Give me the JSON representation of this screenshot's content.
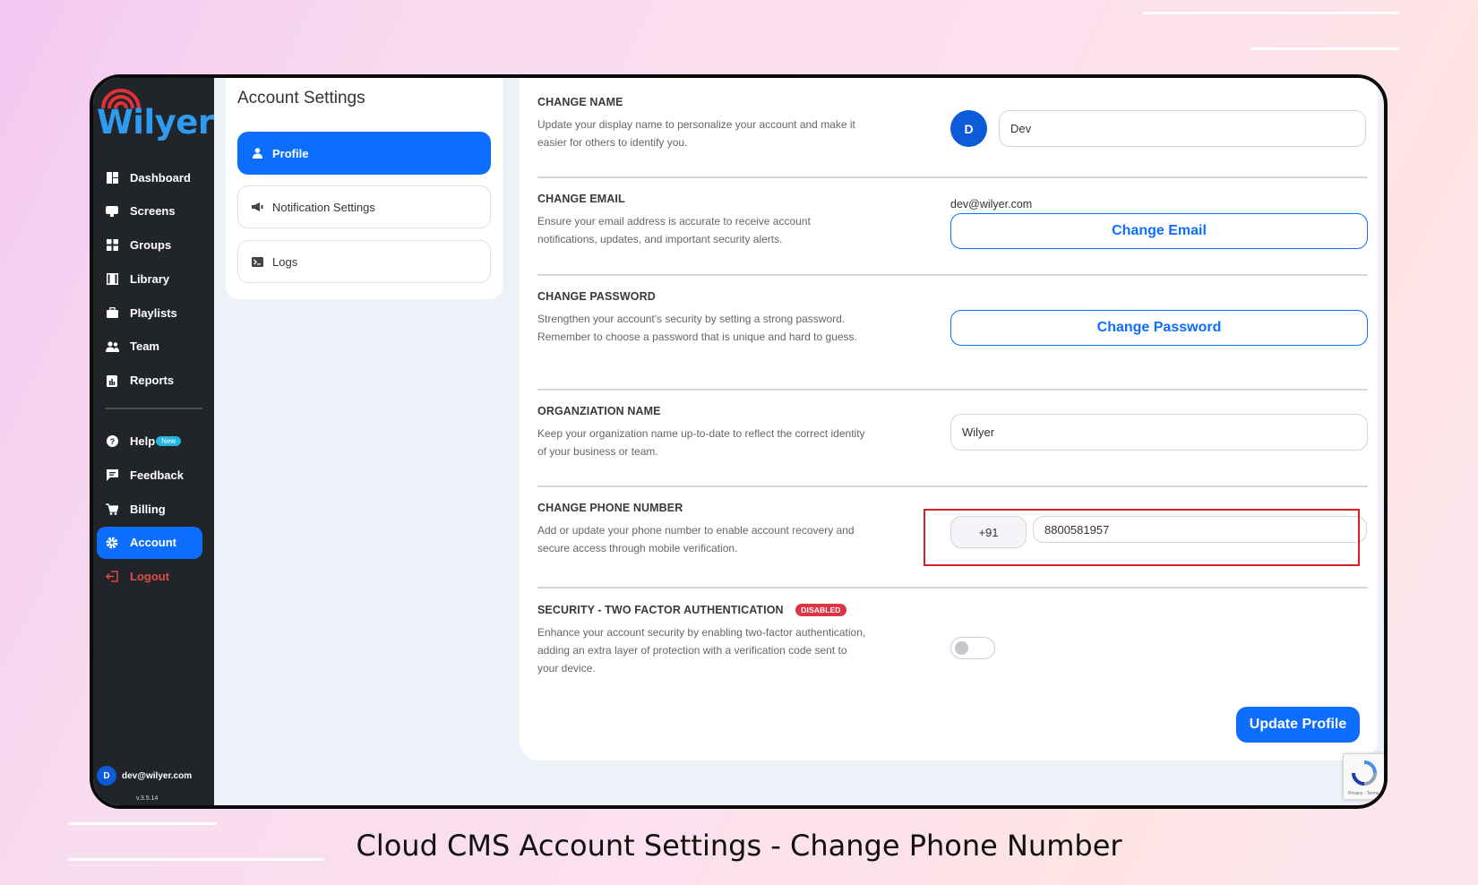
{
  "brand": {
    "name": "Wilyer",
    "accent": "#0d6efd",
    "sidebar_bg": "#212529"
  },
  "sidebar": {
    "items": [
      {
        "label": "Dashboard",
        "icon": "dashboard-icon"
      },
      {
        "label": "Screens",
        "icon": "screen-icon"
      },
      {
        "label": "Groups",
        "icon": "grid-icon"
      },
      {
        "label": "Library",
        "icon": "film-icon"
      },
      {
        "label": "Playlists",
        "icon": "briefcase-icon"
      },
      {
        "label": "Team",
        "icon": "users-icon"
      },
      {
        "label": "Reports",
        "icon": "report-icon"
      }
    ],
    "secondary": [
      {
        "label": "Help",
        "icon": "help-icon",
        "badge": "New"
      },
      {
        "label": "Feedback",
        "icon": "feedback-icon"
      },
      {
        "label": "Billing",
        "icon": "cart-icon"
      },
      {
        "label": "Account",
        "icon": "gear-icon",
        "active": true
      },
      {
        "label": "Logout",
        "icon": "logout-icon"
      }
    ],
    "user": {
      "initial": "D",
      "email": "dev@wilyer.com"
    },
    "version": "v.3.5.14"
  },
  "settings_menu": {
    "title": "Account Settings",
    "items": [
      {
        "label": "Profile",
        "icon": "user-icon",
        "active": true
      },
      {
        "label": "Notification Settings",
        "icon": "megaphone-icon"
      },
      {
        "label": "Logs",
        "icon": "terminal-icon"
      }
    ]
  },
  "profile": {
    "change_name": {
      "title": "CHANGE NAME",
      "description": "Update your display name to personalize your account and make it easier for others to identify you.",
      "avatar_initial": "D",
      "value": "Dev"
    },
    "change_email": {
      "title": "CHANGE EMAIL",
      "description": "Ensure your email address is accurate to receive account notifications, updates, and important security alerts.",
      "current_email": "dev@wilyer.com",
      "button": "Change Email"
    },
    "change_password": {
      "title": "CHANGE PASSWORD",
      "description": "Strengthen your account's security by setting a strong password. Remember to choose a password that is unique and hard to guess.",
      "button": "Change Password"
    },
    "organization": {
      "title": "ORGANZIATION NAME",
      "description": "Keep your organization name up-to-date to reflect the correct identity of your business or team.",
      "value": "Wilyer"
    },
    "phone": {
      "title": "CHANGE PHONE NUMBER",
      "description": "Add or update your phone number to enable account recovery and secure access through mobile verification.",
      "country_code": "+91",
      "value": "8800581957"
    },
    "two_factor": {
      "title": "SECURITY - TWO FACTOR AUTHENTICATION",
      "status": "DISABLED",
      "description": "Enhance your account security by enabling two-factor authentication, adding an extra layer of protection with a verification code sent to your device.",
      "enabled": false
    },
    "update_button": "Update Profile"
  },
  "recaptcha": {
    "label": "Privacy - Terms"
  },
  "caption": "Cloud CMS Account Settings - Change Phone Number"
}
